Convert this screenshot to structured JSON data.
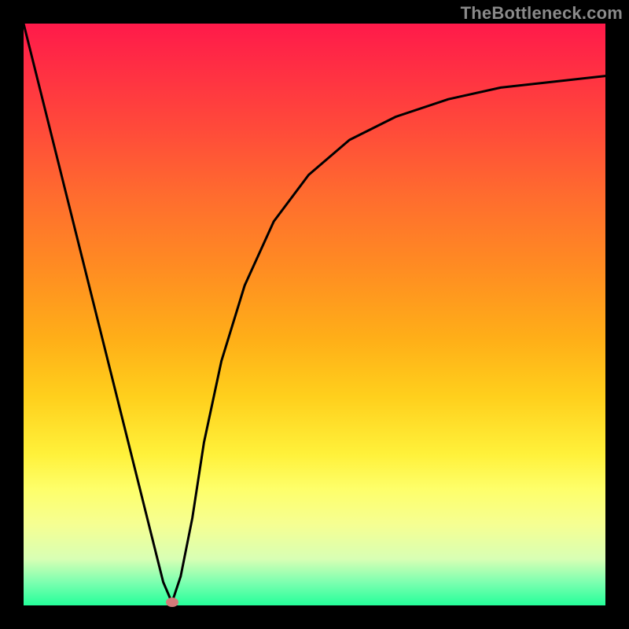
{
  "watermark": "TheBottleneck.com",
  "chart_data": {
    "type": "line",
    "title": "",
    "xlabel": "",
    "ylabel": "",
    "xlim": [
      0,
      100
    ],
    "ylim": [
      0,
      100
    ],
    "grid": false,
    "legend": false,
    "marker": {
      "x": 25.5,
      "y": 0.5
    },
    "series": [
      {
        "name": "curve",
        "x": [
          0,
          5,
          10,
          15,
          20,
          22,
          24,
          25.5,
          27,
          29,
          31,
          34,
          38,
          43,
          49,
          56,
          64,
          73,
          82,
          91,
          100
        ],
        "y": [
          100,
          80,
          60,
          40,
          20,
          12,
          4,
          0.5,
          5,
          15,
          28,
          42,
          55,
          66,
          74,
          80,
          84,
          87,
          89,
          90,
          91
        ]
      }
    ],
    "gradient_stops": [
      {
        "pct": 0,
        "color": "#ff1a4a"
      },
      {
        "pct": 18,
        "color": "#ff4a3a"
      },
      {
        "pct": 42,
        "color": "#ff8c22"
      },
      {
        "pct": 64,
        "color": "#ffcf1c"
      },
      {
        "pct": 80,
        "color": "#feff6a"
      },
      {
        "pct": 96,
        "color": "#7dffb0"
      },
      {
        "pct": 100,
        "color": "#24ff9a"
      }
    ]
  }
}
